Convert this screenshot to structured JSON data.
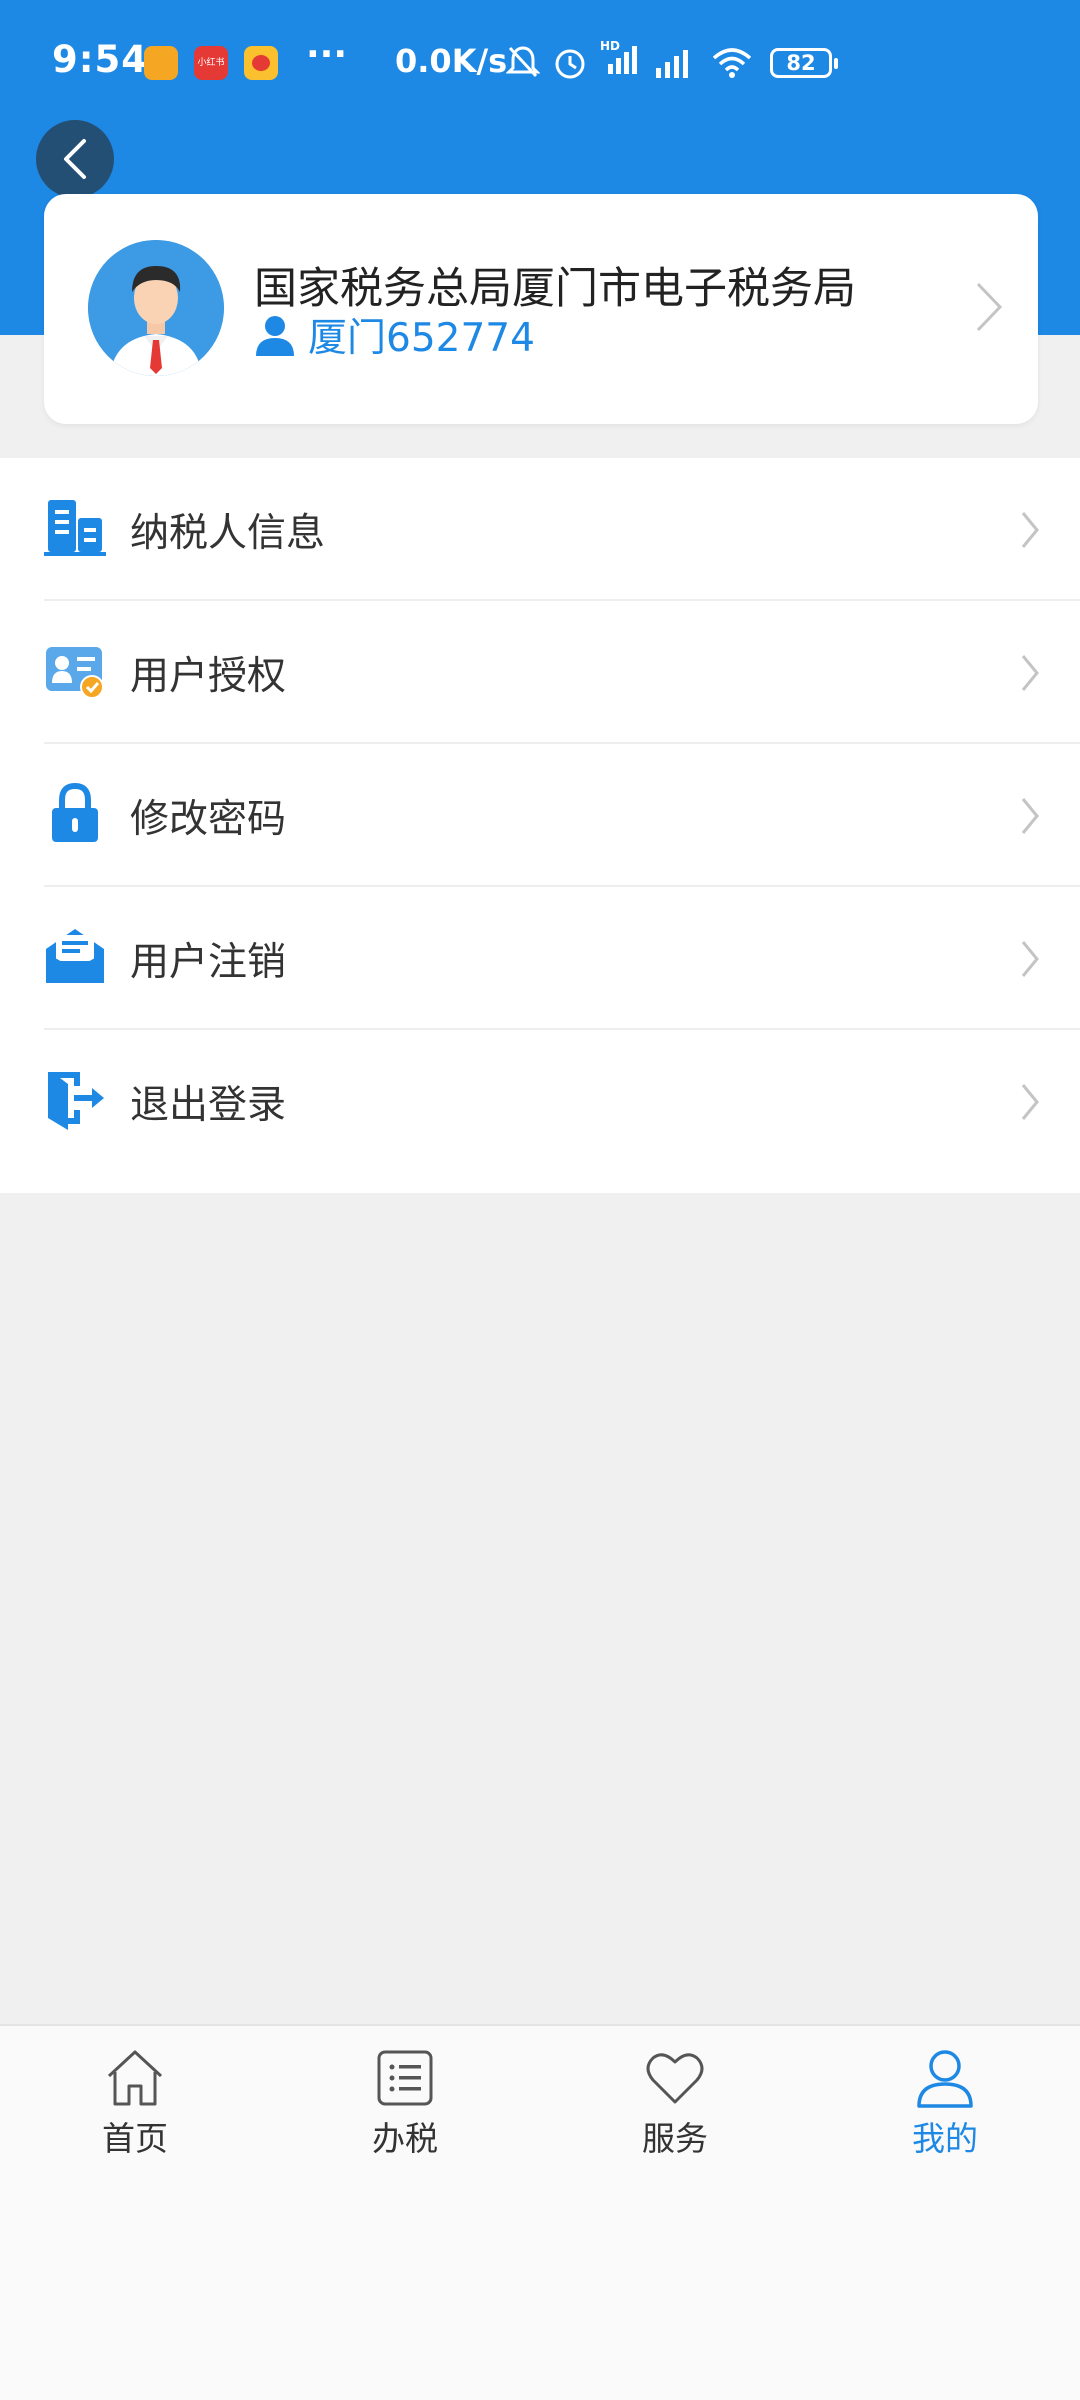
{
  "status_bar": {
    "time": "9:54",
    "app_badge_2": "小红书",
    "dots": "···",
    "net_speed": "0.0K/s",
    "battery": "82",
    "icons": [
      "notification-app-icon",
      "xiaohongshu-icon",
      "weibo-icon",
      "mute-bell-icon",
      "alarm-icon",
      "hd-signal-icon",
      "signal-icon",
      "wifi-icon",
      "battery-icon"
    ]
  },
  "header": {
    "back_icon": "chevron-left-icon",
    "accent_color": "#1e88e5"
  },
  "profile": {
    "org_name": "国家税务总局厦门市电子税务局",
    "user_id": "厦门652774",
    "avatar": "avatar-man-icon"
  },
  "menu": {
    "items": [
      {
        "label": "纳税人信息",
        "icon": "building-icon"
      },
      {
        "label": "用户授权",
        "icon": "id-card-check-icon"
      },
      {
        "label": "修改密码",
        "icon": "lock-icon"
      },
      {
        "label": "用户注销",
        "icon": "envelope-icon"
      },
      {
        "label": "退出登录",
        "icon": "logout-icon"
      }
    ]
  },
  "bottom_nav": {
    "items": [
      {
        "label": "首页",
        "icon": "home-icon"
      },
      {
        "label": "办税",
        "icon": "list-icon"
      },
      {
        "label": "服务",
        "icon": "heart-icon"
      },
      {
        "label": "我的",
        "icon": "user-icon",
        "active": true
      }
    ]
  }
}
